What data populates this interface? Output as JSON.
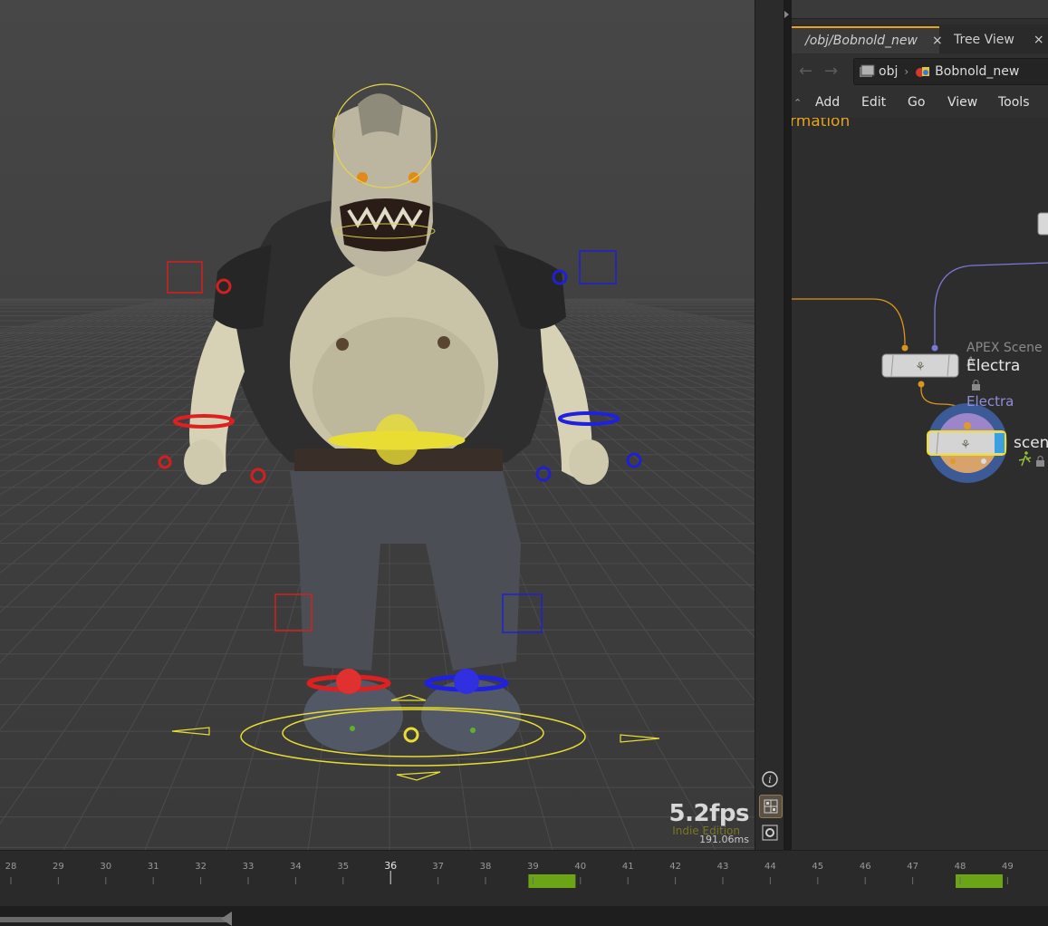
{
  "viewport": {
    "fps": "5.2fps",
    "edition": "Indie Edition",
    "render_time": "191.06ms",
    "toolbar": [
      "info-icon",
      "grid-snap-icon",
      "settings-gear-icon"
    ]
  },
  "tabs": [
    {
      "label": "/obj/Bobnold_new",
      "close": "×",
      "active": true
    },
    {
      "label": "Tree View",
      "close": "×",
      "active": false
    }
  ],
  "path": {
    "segments": [
      "obj",
      "Bobnold_new"
    ],
    "back_icon": "back-arrow-icon",
    "forward_icon": "forward-arrow-icon"
  },
  "menu": [
    "Add",
    "Edit",
    "Go",
    "View",
    "Tools"
  ],
  "network": {
    "section_label": "rmation",
    "nodes": [
      {
        "title": "Electra",
        "type": "APEX Scene A",
        "link": "Electra"
      },
      {
        "title": "scenc"
      }
    ],
    "colors": {
      "accent": "#e8a31b",
      "wire_orange": "#d9961e",
      "wire_purple": "#7c78d6",
      "selected": "#f0e020"
    }
  },
  "timeline": {
    "frames": [
      28,
      29,
      30,
      31,
      32,
      33,
      34,
      35,
      36,
      37,
      38,
      39,
      40,
      41,
      42,
      43,
      44,
      45,
      46,
      47,
      48,
      49
    ],
    "current_frame": 36,
    "keyframes": [
      39,
      48
    ],
    "key_color": "#6ba516"
  }
}
